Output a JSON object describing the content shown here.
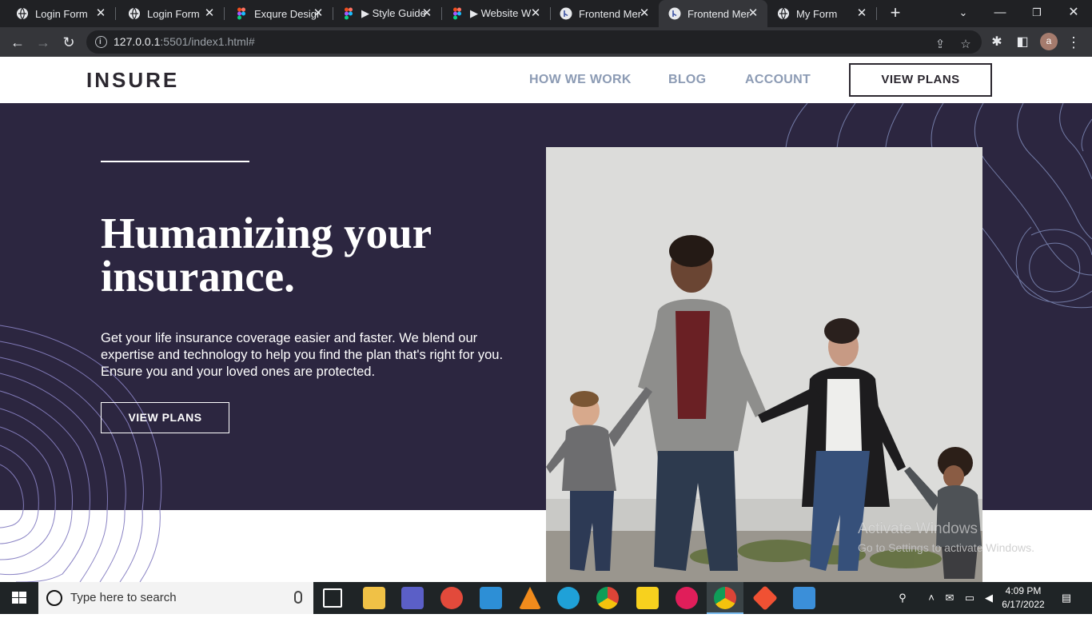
{
  "browser": {
    "tabs": [
      {
        "title": "Login Form",
        "icon": "globe-icon"
      },
      {
        "title": "Login Form",
        "icon": "globe-icon"
      },
      {
        "title": "Exqure Design",
        "icon": "figma-icon"
      },
      {
        "title": "▶ Style Guide",
        "icon": "figma-icon"
      },
      {
        "title": "▶ Website W",
        "icon": "figma-icon"
      },
      {
        "title": "Frontend Mer",
        "icon": "frontend-mentor-icon"
      },
      {
        "title": "Frontend Mer",
        "icon": "frontend-mentor-icon",
        "active": true
      },
      {
        "title": "My Form",
        "icon": "globe-icon"
      }
    ],
    "url_host": "127.0.0.1",
    "url_path": ":5501/index1.html#",
    "profile_initial": "a"
  },
  "site": {
    "logo": "INSURE",
    "nav": [
      "HOW WE WORK",
      "BLOG",
      "ACCOUNT"
    ],
    "header_cta": "VIEW PLANS",
    "hero": {
      "title": "Humanizing your insurance.",
      "text": "Get your life insurance coverage easier and faster. We blend our expertise and technology to help you find the plan that's right for you. Ensure you and your loved ones are protected.",
      "cta": "VIEW PLANS"
    }
  },
  "watermark": {
    "title": "Activate Windows",
    "subtitle": "Go to Settings to activate Windows."
  },
  "taskbar": {
    "search_placeholder": "Type here to search",
    "time": "4:09 PM",
    "date": "6/17/2022",
    "apps": [
      "task-view-icon",
      "file-explorer-icon",
      "teams-icon",
      "media-player-icon",
      "vscode-icon",
      "vlc-icon",
      "edge-icon",
      "chrome-icon",
      "sticky-notes-icon",
      "slack-icon",
      "chrome-icon",
      "git-icon",
      "photos-icon"
    ]
  },
  "colors": {
    "hero_bg": "#2c2640",
    "nav_link": "#8c9bb4",
    "logo": "#2c2830"
  }
}
